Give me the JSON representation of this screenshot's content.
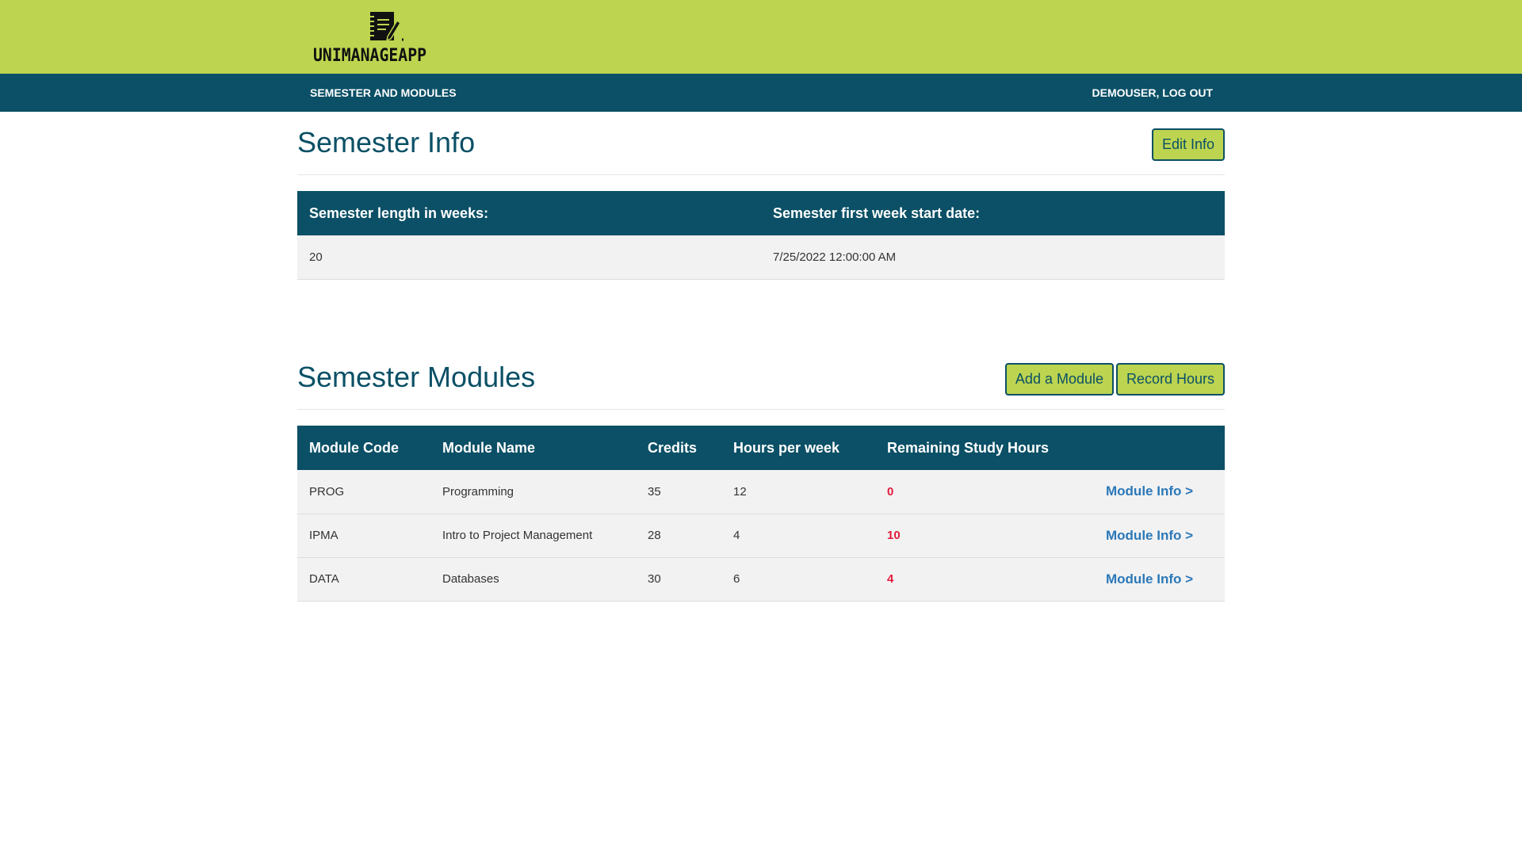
{
  "app": {
    "logo_text": "UNIMANAGEAPP",
    "logo_icon": "notebook-pencil-icon"
  },
  "nav": {
    "left_label": "SEMESTER AND MODULES",
    "right_label": "DEMOUSER, LOG OUT"
  },
  "semester_info": {
    "title": "Semester Info",
    "edit_button": "Edit Info",
    "headers": {
      "length": "Semester length in weeks:",
      "start_date": "Semester first week start date:"
    },
    "values": {
      "length": "20",
      "start_date": "7/25/2022 12:00:00 AM"
    }
  },
  "modules": {
    "title": "Semester Modules",
    "add_button": "Add a Module",
    "record_button": "Record Hours",
    "headers": {
      "code": "Module Code",
      "name": "Module Name",
      "credits": "Credits",
      "hours": "Hours per week",
      "remaining": "Remaining Study Hours"
    },
    "rows": [
      {
        "code": "PROG",
        "name": "Programming",
        "credits": "35",
        "hours": "12",
        "remaining": "0",
        "link": "Module Info >"
      },
      {
        "code": "IPMA",
        "name": "Intro to Project Management",
        "credits": "28",
        "hours": "4",
        "remaining": "10",
        "link": "Module Info >"
      },
      {
        "code": "DATA",
        "name": "Databases",
        "credits": "30",
        "hours": "6",
        "remaining": "4",
        "link": "Module Info >"
      }
    ]
  },
  "colors": {
    "accent_green": "#bcd44f",
    "primary_teal": "#0b5066",
    "warning_red": "#e31b3b",
    "link_blue": "#2b78b8"
  }
}
